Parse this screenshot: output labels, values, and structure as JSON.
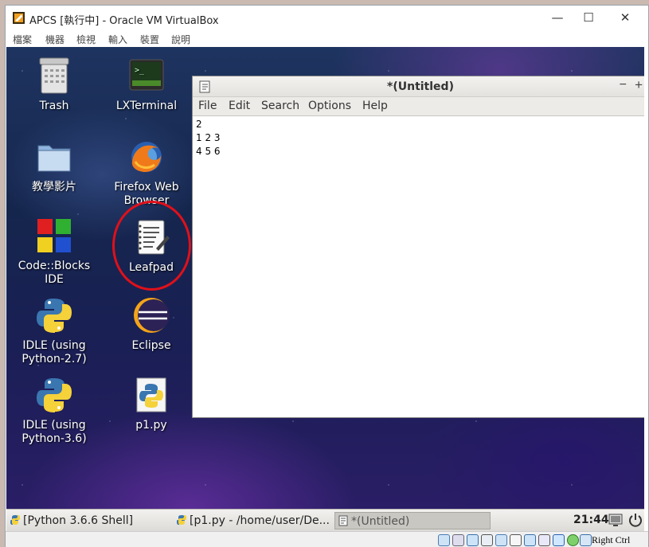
{
  "window": {
    "title": "APCS [執行中] - Oracle VM VirtualBox",
    "minimize": "—",
    "maximize": "☐",
    "close": "✕"
  },
  "menubar": [
    "檔案",
    "機器",
    "檢視",
    "輸入",
    "裝置",
    "說明"
  ],
  "desktop_icons": [
    {
      "label": "Trash",
      "icon": "trash-icon"
    },
    {
      "label": "LXTerminal",
      "icon": "terminal-icon"
    },
    {
      "label": "教學影片",
      "icon": "folder-icon"
    },
    {
      "label": "Firefox Web Browser",
      "icon": "firefox-icon"
    },
    {
      "label": "Code::Blocks IDE",
      "icon": "codeblocks-icon"
    },
    {
      "label": "Leafpad",
      "icon": "leafpad-icon"
    },
    {
      "label": "IDLE (using Python-2.7)",
      "icon": "python-icon"
    },
    {
      "label": "Eclipse",
      "icon": "eclipse-icon"
    },
    {
      "label": "IDLE (using Python-3.6)",
      "icon": "python-icon"
    },
    {
      "label": "p1.py",
      "icon": "python-file-icon"
    }
  ],
  "leafpad": {
    "title": "*(Untitled)",
    "min": "−",
    "max": "+",
    "menu": [
      "File",
      "Edit",
      "Search",
      "Options",
      "Help"
    ],
    "content": "2\n1 2 3\n4 5 6"
  },
  "taskbar": {
    "items": [
      {
        "label": "[Python 3.6.6 Shell]",
        "active": false
      },
      {
        "label": "[p1.py - /home/user/De...",
        "active": false
      },
      {
        "label": "*(Untitled)",
        "active": true
      }
    ],
    "clock": "21:44"
  },
  "statusbar": {
    "host_key": "Right Ctrl"
  },
  "colors": {
    "highlight_circle": "#e0101a"
  }
}
